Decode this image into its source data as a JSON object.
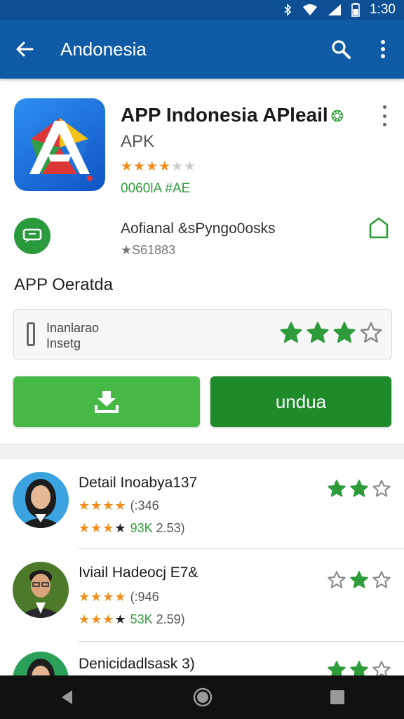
{
  "status_bar": {
    "time": "1:30"
  },
  "app_bar": {
    "title": "Andonesia",
    "back_icon": "arrow-back-icon",
    "search_icon": "search-icon",
    "menu_icon": "more-vert-icon"
  },
  "app": {
    "name": "APP Indonesia APleail",
    "subtitle": "APK",
    "stars": "★★★★★",
    "code": "0060lA #AE"
  },
  "developer": {
    "name": "Aofianal &sPyngo0osks",
    "count": "★S61883"
  },
  "section_title": "APP Oeratda",
  "rating_box": {
    "line1": "Inanlarao",
    "line2": "Insetg",
    "rating": 3
  },
  "buttons": {
    "download_icon": "download-icon",
    "unduh_label": "undua"
  },
  "reviews": [
    {
      "name": "Detail Inoabya137",
      "line1_stars": "★★★★",
      "line1_text": "(:346",
      "line2_stars_orange": "★★★",
      "line2_stars_black": "★",
      "line2_green": "93K",
      "line2_text": "2.53)",
      "rating": 2
    },
    {
      "name": "Iviail Hadeocj E7&",
      "line1_stars": "★★★★",
      "line1_text": "(:946",
      "line2_stars_orange": "★★★",
      "line2_stars_black": "★",
      "line2_green": "53K",
      "line2_text": "2.59)",
      "rating": 1
    },
    {
      "name": "Denicidadlsask 3)",
      "rating": 2
    }
  ],
  "colors": {
    "primary": "#0f5ba6",
    "green": "#2e9c3a",
    "button_green": "#46b845",
    "dark_green": "#1e8a2a",
    "star_orange": "#f08c1a"
  }
}
